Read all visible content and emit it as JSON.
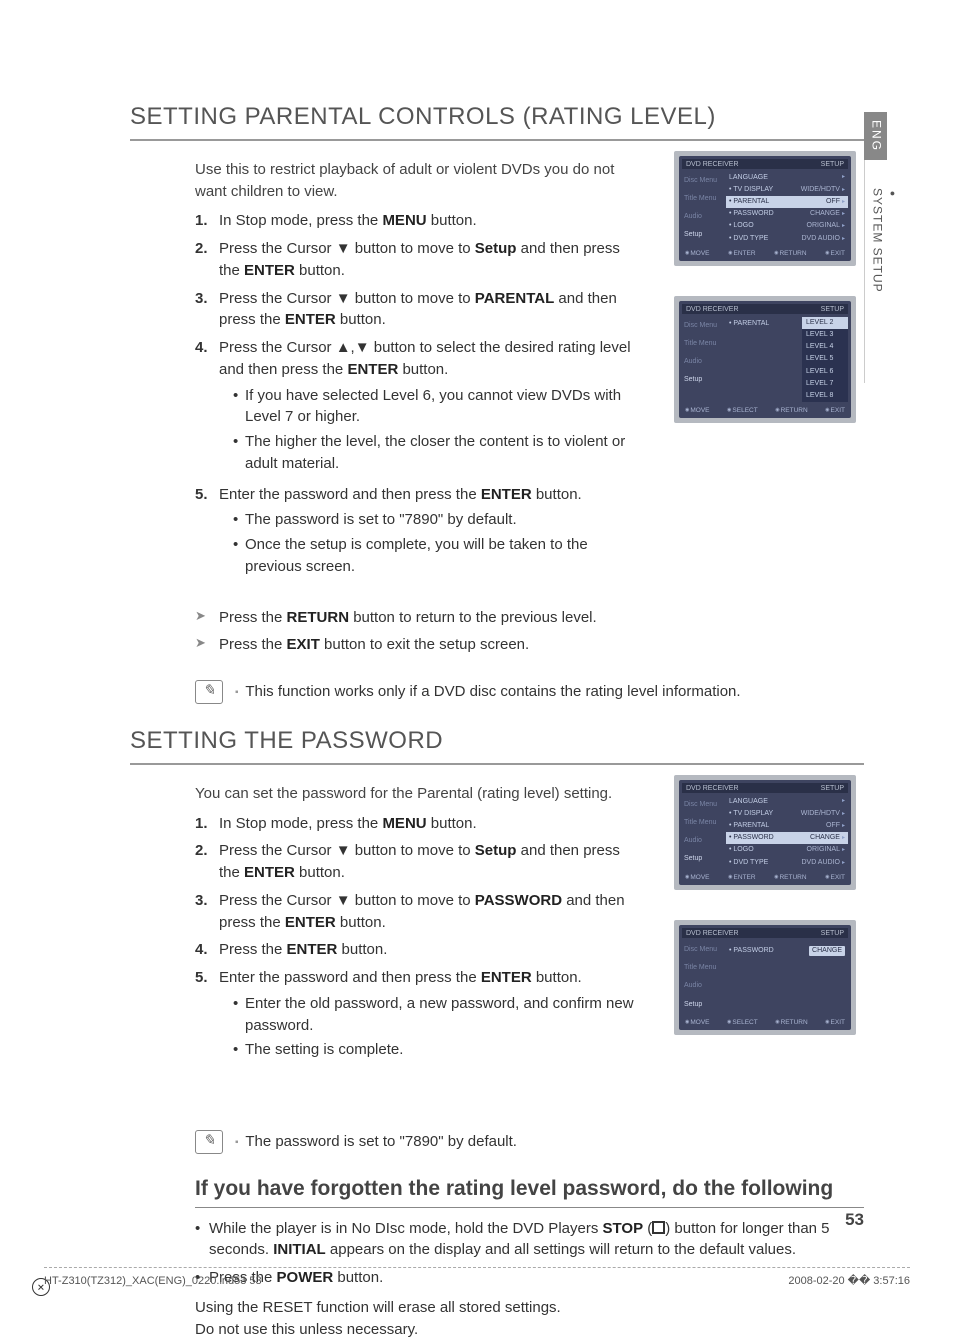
{
  "side": {
    "lang": "ENG",
    "section": "SYSTEM SETUP"
  },
  "section1": {
    "title": "SETTING PARENTAL CONTROLS (RATING LEVEL)",
    "intro": "Use this to restrict playback of adult or violent DVDs you do not want children to view.",
    "steps": [
      {
        "n": "1.",
        "pre": "In Stop mode, press the ",
        "b1": "MENU",
        "post": " button."
      },
      {
        "n": "2.",
        "pre": "Press the Cursor ▼ button to move to ",
        "b1": "Setup",
        "mid": " and then press the ",
        "b2": "ENTER",
        "post": " button."
      },
      {
        "n": "3.",
        "pre": "Press the Cursor ▼ button to move to ",
        "b1": "PARENTAL",
        "mid": " and then press the ",
        "b2": "ENTER",
        "post": " button."
      },
      {
        "n": "4.",
        "pre": "Press the Cursor ▲,▼ button to select the desired rating level and then press the ",
        "b1": "ENTER",
        "post": " button.",
        "subs": [
          "If you have selected Level 6, you cannot view DVDs with Level 7 or higher.",
          "The higher the level, the closer the content is to violent or adult material."
        ]
      },
      {
        "n": "5.",
        "pre": "Enter the password and then press the ",
        "b1": "ENTER",
        "post": " button.",
        "subs": [
          "The password is set to \"7890\" by default.",
          "Once the setup is complete, you will be taken to the previous screen."
        ]
      }
    ],
    "arrows": [
      {
        "pre": "Press the ",
        "b": "RETURN",
        "post": " button to return to the previous level."
      },
      {
        "pre": "Press the ",
        "b": "EXIT",
        "post": " button to exit the setup screen."
      }
    ],
    "note": "This function works only if a DVD disc contains the rating level information."
  },
  "section2": {
    "title": "SETTING THE PASSWORD",
    "intro": "You can set the password for the Parental (rating level) setting.",
    "steps": [
      {
        "n": "1.",
        "pre": "In Stop mode, press the ",
        "b1": "MENU",
        "post": " button."
      },
      {
        "n": "2.",
        "pre": "Press the Cursor ▼ button to move to ",
        "b1": "Setup",
        "mid": " and then press the ",
        "b2": "ENTER",
        "post": " button."
      },
      {
        "n": "3.",
        "pre": "Press the Cursor ▼ button to move to ",
        "b1": "PASSWORD",
        "mid": " and then press the ",
        "b2": "ENTER",
        "post": " button."
      },
      {
        "n": "4.",
        "pre": "Press the ",
        "b1": "ENTER",
        "post": " button."
      },
      {
        "n": "5.",
        "pre": "Enter the password and then press the ",
        "b1": "ENTER",
        "post": " button.",
        "subs": [
          "Enter the old password, a new password, and confirm new password.",
          "The setting is complete."
        ]
      }
    ],
    "note": "The password is set to \"7890\" by default."
  },
  "forgotten": {
    "heading": "If you have forgotten the rating level password, do the following",
    "b1_pre": "While the player is in No DIsc mode, hold the DVD Players ",
    "b1_b": "STOP",
    "b1_mid": " (",
    "b1_post": ") button for longer than 5 seconds. ",
    "b1_b2": "INITIAL",
    "b1_tail": " appears on the display and all settings will return to the default values.",
    "b2_pre": "Press the ",
    "b2_b": "POWER",
    "b2_post": " button.",
    "warn1": "Using the RESET function will erase all stored settings.",
    "warn2": "Do not use this unless necessary."
  },
  "osd": {
    "titleLeft": "DVD RECEIVER",
    "titleRight": "SETUP",
    "tabs": [
      "Disc Menu",
      "Title Menu",
      "Audio",
      "Setup"
    ],
    "screen1": {
      "rows": [
        {
          "l": "LANGUAGE",
          "v": "",
          "hl": false
        },
        {
          "l": "TV DISPLAY",
          "v": "WIDE/HDTV",
          "hl": false
        },
        {
          "l": "PARENTAL",
          "v": "OFF",
          "hl": true
        },
        {
          "l": "PASSWORD",
          "v": "CHANGE",
          "hl": false
        },
        {
          "l": "LOGO",
          "v": "ORIGINAL",
          "hl": false
        },
        {
          "l": "DVD TYPE",
          "v": "DVD AUDIO",
          "hl": false
        }
      ],
      "footer": [
        "MOVE",
        "ENTER",
        "RETURN",
        "EXIT"
      ]
    },
    "screen2": {
      "label": "PARENTAL",
      "levels": [
        "LEVEL 2",
        "LEVEL 3",
        "LEVEL 4",
        "LEVEL 5",
        "LEVEL 6",
        "LEVEL 7",
        "LEVEL 8"
      ],
      "footer": [
        "MOVE",
        "SELECT",
        "RETURN",
        "EXIT"
      ]
    },
    "screen3": {
      "rows": [
        {
          "l": "LANGUAGE",
          "v": "",
          "hl": false
        },
        {
          "l": "TV DISPLAY",
          "v": "WIDE/HDTV",
          "hl": false
        },
        {
          "l": "PARENTAL",
          "v": "OFF",
          "hl": false
        },
        {
          "l": "PASSWORD",
          "v": "CHANGE",
          "hl": true
        },
        {
          "l": "LOGO",
          "v": "ORIGINAL",
          "hl": false
        },
        {
          "l": "DVD TYPE",
          "v": "DVD AUDIO",
          "hl": false
        }
      ],
      "footer": [
        "MOVE",
        "ENTER",
        "RETURN",
        "EXIT"
      ]
    },
    "screen4": {
      "label": "PASSWORD",
      "value": "CHANGE",
      "footer": [
        "MOVE",
        "SELECT",
        "RETURN",
        "EXIT"
      ]
    }
  },
  "pageNum": "53",
  "footer": {
    "left": "HT-Z310(TZ312)_XAC(ENG)_0220.ind53   53",
    "right": "2008-02-20   �� 3:57:16"
  }
}
